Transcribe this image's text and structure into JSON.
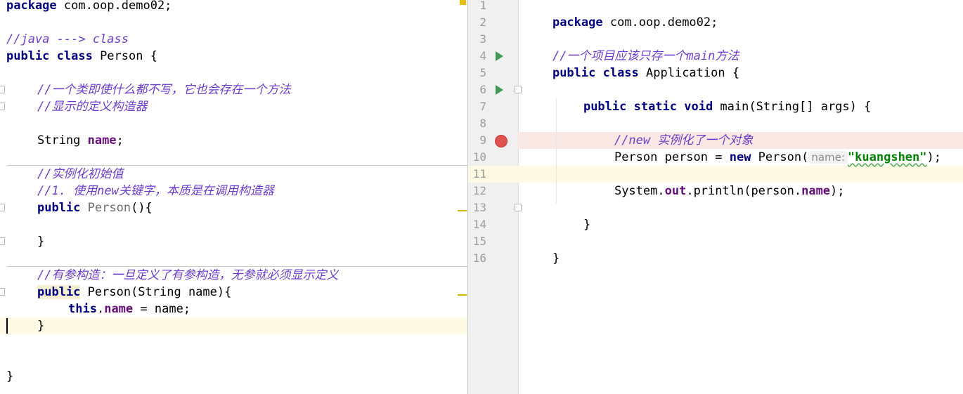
{
  "left_editor": {
    "lines": [
      {
        "text_package_kw": "package",
        "text_package_rest": " com.oop.demo02;"
      },
      {
        "comment_java_class": "//java ---> class"
      },
      {
        "kw_public_class": "public class",
        "class_name": " Person {"
      },
      {
        "comment_1": "//一个类即使什么都不写，它也会存在一个方法"
      },
      {
        "comment_2": "//显示的定义构造器"
      },
      {
        "type_string": "String ",
        "field_name": "name",
        ";": ";"
      },
      {
        "comment_3": "//实例化初始值"
      },
      {
        "comment_4": "//1. 使用new关键字，本质是在调用构造器"
      },
      {
        "kw_public": "public",
        "ctor_name": " Person",
        "ctor_rest": "(){"
      },
      {
        "close": "}"
      },
      {
        "comment_5": "//有参构造：一旦定义了有参构造，无参就必须显示定义"
      },
      {
        "kw_public": "public",
        "ctor_sig": " Person(String name){"
      },
      {
        "kw_this": "this",
        "dot": ".",
        "field": "name",
        "rest": " = name;"
      },
      {
        "close": "}"
      },
      {
        "close": "}"
      }
    ]
  },
  "right_editor": {
    "line_numbers": [
      "1",
      "2",
      "3",
      "4",
      "5",
      "6",
      "7",
      "8",
      "9",
      "10",
      "11",
      "12",
      "13",
      "14",
      "15",
      "16"
    ],
    "l1_kw": "package",
    "l1_rest": " com.oop.demo02;",
    "l3_comment": "//一个项目应该只存一个main方法",
    "l4_kw": "public class",
    "l4_rest": " Application {",
    "l6_kw": "public static void",
    "l6_rest": " main(String[] args) {",
    "l8_comment": "//new 实例化了一个对象",
    "l9_a": "Person person = ",
    "l9_kw": "new",
    "l9_b": " Person(",
    "l9_hint": "name:",
    "l9_str": "\"kuangshen\"",
    "l9_end": ");",
    "l11_a": "System.",
    "l11_out": "out",
    "l11_b": ".println(person.",
    "l11_field": "name",
    "l11_end": ");",
    "l13": "}",
    "l15": "}"
  },
  "colors": {
    "keyword": "#000080",
    "comment": "#6c3cc8",
    "field": "#660e7a",
    "string": "#008000",
    "run_icon": "#3f9a52",
    "breakpoint": "#e0514f",
    "current_line": "#fdf9e3"
  },
  "icons": [
    "run-gutter-icon",
    "breakpoint-icon",
    "fold-marker-icon",
    "warning-stripe-icon"
  ]
}
